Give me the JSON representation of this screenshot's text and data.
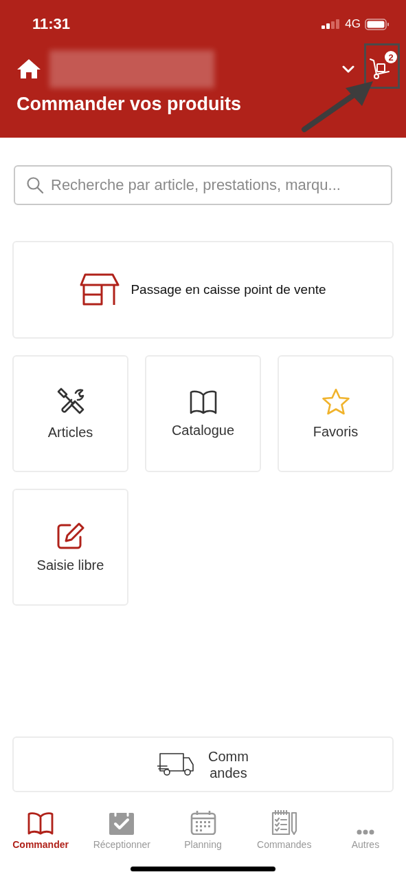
{
  "status_bar": {
    "time": "11:31",
    "network": "4G"
  },
  "header": {
    "title": "Commander vos produits",
    "cart_count": "2"
  },
  "search": {
    "placeholder": "Recherche par article, prestations, marqu..."
  },
  "checkout": {
    "label": "Passage en caisse point de vente"
  },
  "shortcuts": [
    {
      "kind": "tools",
      "label": "Articles"
    },
    {
      "kind": "book",
      "label": "Catalogue"
    },
    {
      "kind": "star",
      "label": "Favoris"
    },
    {
      "kind": "edit",
      "label": "Saisie libre"
    }
  ],
  "orders_button": {
    "label_lines": [
      "Comm",
      "andes"
    ]
  },
  "tabs": [
    {
      "kind": "book",
      "label": "Commander",
      "selected": true
    },
    {
      "kind": "check",
      "label": "Réceptionner",
      "selected": false
    },
    {
      "kind": "calendar",
      "label": "Planning",
      "selected": false
    },
    {
      "kind": "list",
      "label": "Commandes",
      "selected": false
    },
    {
      "kind": "more",
      "label": "Autres",
      "selected": false
    }
  ]
}
